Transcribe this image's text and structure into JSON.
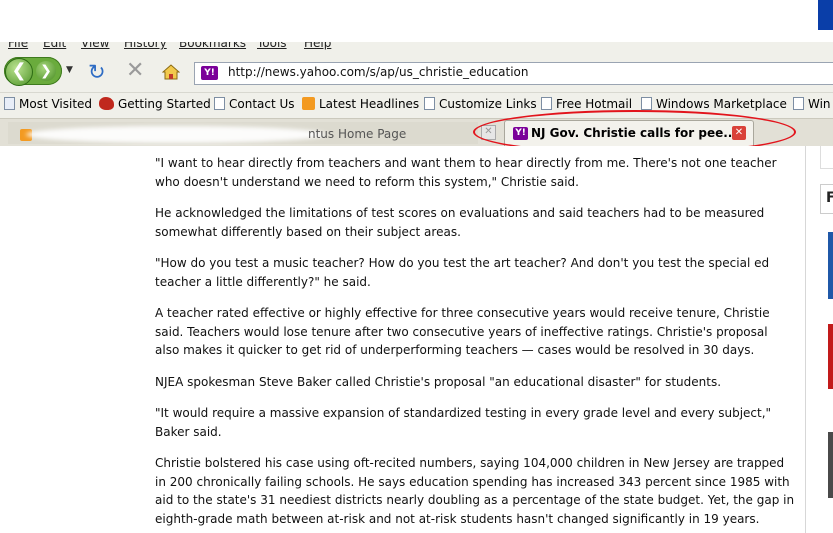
{
  "menubar": {
    "items": [
      "File",
      "Edit",
      "View",
      "History",
      "Bookmarks",
      "Tools",
      "Help"
    ]
  },
  "navbar": {
    "back_glyph": "❮",
    "forward_glyph": "❯",
    "reload_glyph": "↻",
    "stop_glyph": "✕",
    "dropdown_glyph": "▼",
    "url": "http://news.yahoo.com/s/ap/us_christie_education",
    "favicon_text": "Y!"
  },
  "bookmarks": [
    {
      "label": "Most Visited",
      "icon": "document-icon"
    },
    {
      "label": "Getting Started",
      "icon": "firefox-icon"
    },
    {
      "label": "Contact Us",
      "icon": "document-icon"
    },
    {
      "label": "Latest Headlines",
      "icon": "rss-icon"
    },
    {
      "label": "Customize Links",
      "icon": "document-icon"
    },
    {
      "label": "Free Hotmail",
      "icon": "document-icon"
    },
    {
      "label": "Windows Marketplace",
      "icon": "document-icon"
    },
    {
      "label": "Win",
      "icon": "document-icon"
    }
  ],
  "tabs": {
    "background_tab_visible_text": "ntus Home Page",
    "active_tab_title": "NJ Gov. Christie calls for pee...",
    "active_tab_favicon": "Y!",
    "close_glyph": "✕"
  },
  "colors": {
    "highlight_ring": "#e2141c",
    "yahoo_purple": "#7b0099",
    "nav_green": "#6aab3c"
  },
  "article": {
    "paragraphs": [
      "\"I want to hear directly from teachers and want them to hear directly from me. There's not one teacher who doesn't understand we need to reform this system,\" Christie said.",
      "He acknowledged the limitations of test scores on evaluations and said teachers had to be measured somewhat differently based on their subject areas.",
      "\"How do you test a music teacher? How do you test the art teacher? And don't you test the special ed teacher a little differently?\" he said.",
      "A teacher rated effective or highly effective for three consecutive years would receive tenure, Christie said. Teachers would lose tenure after two consecutive years of ineffective ratings. Christie's proposal also makes it quicker to get rid of underperforming teachers — cases would be resolved in 30 days.",
      "NJEA spokesman Steve Baker called Christie's proposal \"an educational disaster\" for students.",
      "\"It would require a massive expansion of standardized testing in every grade level and every subject,\" Baker said.",
      "Christie bolstered his case using oft-recited numbers, saying 104,000 children in New Jersey are trapped in 200 chronically failing schools. He says education spending has increased 343 percent since 1985 with aid to the state's 31 neediest districts nearly doubling as a percentage of the state budget. Yet, the gap in eighth-grade math between at-risk and not at-risk students hasn't changed significantly in 19 years."
    ]
  },
  "sidebar": {
    "heading_fragment": "F"
  }
}
